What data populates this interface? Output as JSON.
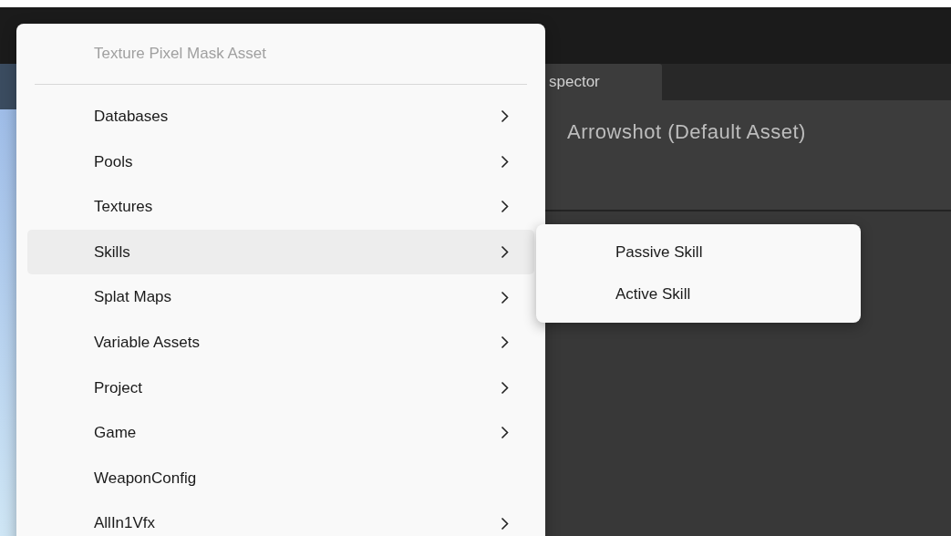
{
  "inspector": {
    "tabs": [
      {
        "label": "spector",
        "selected": true
      }
    ],
    "title": "Arrowshot (Default Asset)"
  },
  "context_menu": {
    "header": "Texture Pixel Mask Asset",
    "items": [
      {
        "label": "Databases",
        "has_submenu": true,
        "selected": false
      },
      {
        "label": "Pools",
        "has_submenu": true,
        "selected": false
      },
      {
        "label": "Textures",
        "has_submenu": true,
        "selected": false
      },
      {
        "label": "Skills",
        "has_submenu": true,
        "selected": true
      },
      {
        "label": "Splat Maps",
        "has_submenu": true,
        "selected": false
      },
      {
        "label": "Variable Assets",
        "has_submenu": true,
        "selected": false
      },
      {
        "label": "Project",
        "has_submenu": true,
        "selected": false
      },
      {
        "label": "Game",
        "has_submenu": true,
        "selected": false
      },
      {
        "label": "WeaponConfig",
        "has_submenu": false,
        "selected": false
      },
      {
        "label": "AllIn1Vfx",
        "has_submenu": true,
        "selected": false
      }
    ]
  },
  "submenu": {
    "items": [
      {
        "label": "Passive Skill"
      },
      {
        "label": "Active Skill"
      }
    ]
  }
}
